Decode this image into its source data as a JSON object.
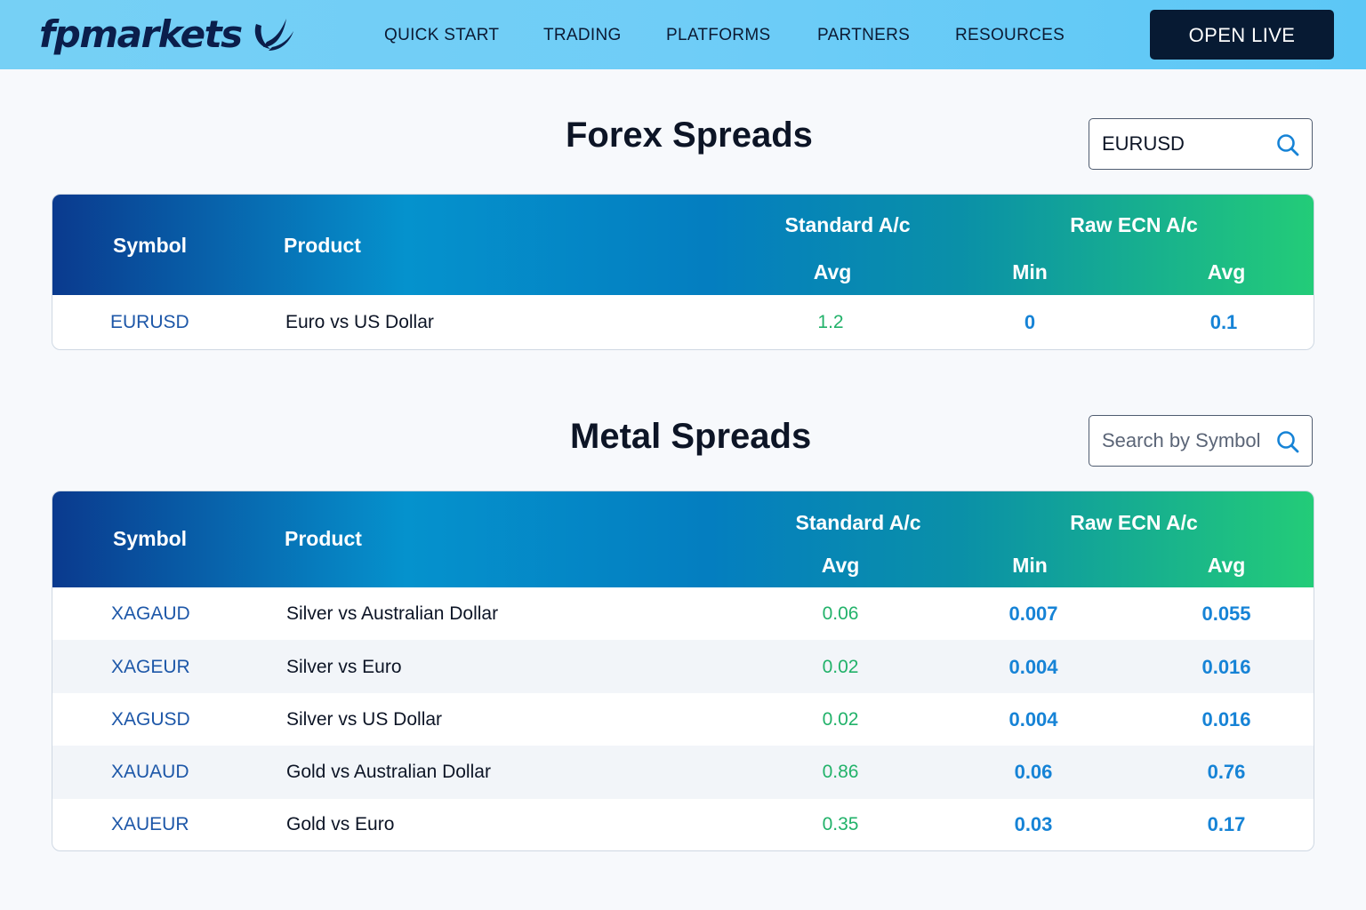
{
  "header": {
    "logo_text": "fpmarkets",
    "nav": [
      {
        "label": "QUICK START"
      },
      {
        "label": "TRADING"
      },
      {
        "label": "PLATFORMS"
      },
      {
        "label": "PARTNERS"
      },
      {
        "label": "RESOURCES"
      }
    ],
    "cta_label": "OPEN LIVE"
  },
  "forex": {
    "title": "Forex Spreads",
    "search": {
      "value": "EURUSD",
      "placeholder": ""
    },
    "columns": {
      "symbol": "Symbol",
      "product": "Product",
      "standard_group": "Standard A/c",
      "raw_group": "Raw ECN A/c",
      "standard_avg": "Avg",
      "raw_min": "Min",
      "raw_avg": "Avg"
    },
    "rows": [
      {
        "symbol": "EURUSD",
        "product": "Euro vs US Dollar",
        "std_avg": "1.2",
        "raw_min": "0",
        "raw_avg": "0.1"
      }
    ]
  },
  "metal": {
    "title": "Metal Spreads",
    "search": {
      "value": "",
      "placeholder": "Search by Symbol"
    },
    "columns": {
      "symbol": "Symbol",
      "product": "Product",
      "standard_group": "Standard A/c",
      "raw_group": "Raw ECN A/c",
      "standard_avg": "Avg",
      "raw_min": "Min",
      "raw_avg": "Avg"
    },
    "rows": [
      {
        "symbol": "XAGAUD",
        "product": "Silver vs Australian Dollar",
        "std_avg": "0.06",
        "raw_min": "0.007",
        "raw_avg": "0.055"
      },
      {
        "symbol": "XAGEUR",
        "product": "Silver vs Euro",
        "std_avg": "0.02",
        "raw_min": "0.004",
        "raw_avg": "0.016"
      },
      {
        "symbol": "XAGUSD",
        "product": "Silver vs US Dollar",
        "std_avg": "0.02",
        "raw_min": "0.004",
        "raw_avg": "0.016"
      },
      {
        "symbol": "XAUAUD",
        "product": "Gold vs Australian Dollar",
        "std_avg": "0.86",
        "raw_min": "0.06",
        "raw_avg": "0.76"
      },
      {
        "symbol": "XAUEUR",
        "product": "Gold vs Euro",
        "std_avg": "0.35",
        "raw_min": "0.03",
        "raw_avg": "0.17"
      }
    ]
  },
  "colors": {
    "brand_navy": "#0b1e4b",
    "header_bg": "#6fcdf7",
    "cta_bg": "#071a33",
    "symbol_text": "#1d57a8",
    "standard_value": "#22b26a",
    "raw_value": "#1683d6"
  },
  "icons": {
    "logo_mark": "swoosh-logo-icon",
    "search": "search-icon"
  }
}
